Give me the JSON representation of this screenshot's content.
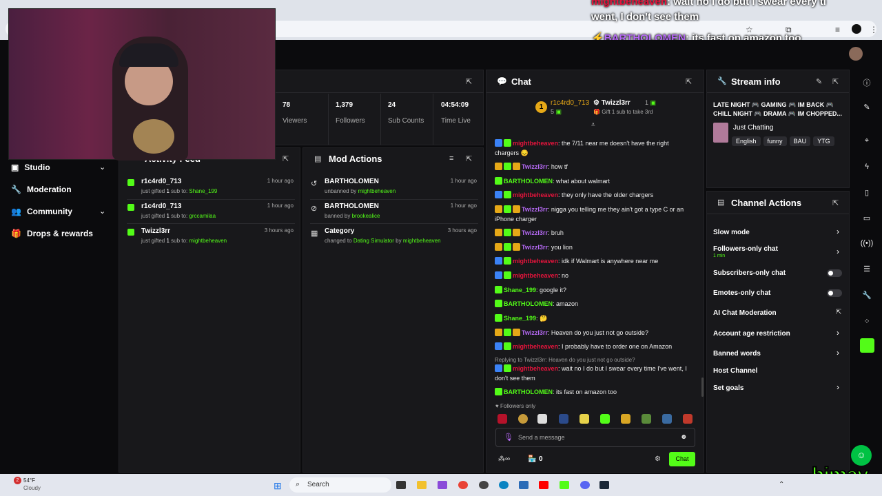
{
  "overlay": {
    "line1_user": "mightbeheaven",
    "line1_text": ": wait no I do but I swear every ti",
    "line2_text": "went, I don't see them",
    "line3_user": "BARTHOLOMEN",
    "line3_text": ": its fast on amazon too"
  },
  "sidebar": {
    "items": [
      {
        "label": "Studio",
        "icon": "video-icon",
        "chevron": true
      },
      {
        "label": "Moderation",
        "icon": "wrench-icon",
        "chevron": false
      },
      {
        "label": "Community",
        "icon": "users-icon",
        "chevron": true
      },
      {
        "label": "Drops & rewards",
        "icon": "gift-icon",
        "chevron": false
      }
    ]
  },
  "stats": [
    {
      "value": "78",
      "label": "Viewers"
    },
    {
      "value": "1,379",
      "label": "Followers"
    },
    {
      "value": "24",
      "label": "Sub Counts"
    },
    {
      "value": "04:54:09",
      "label": "Time Live"
    }
  ],
  "activity_feed": {
    "title": "Activity Feed",
    "items": [
      {
        "name": "r1c4rd0_713",
        "pre": "just gifted ",
        "count": "1",
        "mid": " sub to: ",
        "target": "Shane_199",
        "time": "1 hour ago"
      },
      {
        "name": "r1c4rd0_713",
        "pre": "just gifted ",
        "count": "1",
        "mid": " sub to: ",
        "target": "grccamilaa",
        "time": "1 hour ago"
      },
      {
        "name": "Twizzl3rr",
        "pre": "just gifted ",
        "count": "1",
        "mid": " sub to: ",
        "target": "mightbeheaven",
        "time": "3 hours ago"
      }
    ]
  },
  "mod_actions": {
    "title": "Mod Actions",
    "items": [
      {
        "name": "BARTHOLOMEN",
        "pre": "unbanned by ",
        "target": "mightbeheaven",
        "time": "1 hour ago",
        "icon": "undo-icon"
      },
      {
        "name": "BARTHOLOMEN",
        "pre": "banned by ",
        "target": "brookealice",
        "time": "1 hour ago",
        "icon": "ban-icon"
      },
      {
        "name": "Category",
        "pre": "changed to ",
        "target": "Dating Simulator",
        "post": " by ",
        "target2": "mightbeheaven",
        "time": "3 hours ago",
        "icon": "category-icon"
      }
    ]
  },
  "chat": {
    "title": "Chat",
    "gifter_name": "r1c4rd0_713",
    "gifter_count": "5",
    "gifter2_name": "Twizzl3rr",
    "gifter2_count": "1",
    "gift_prompt": "Gift 1 sub to take 3rd",
    "messages": [
      {
        "user": "mightbeheaven",
        "color": "red",
        "badges": [
          "blue",
          "green"
        ],
        "text": ": the 7/11 near me doesn't have the right chargers 😔"
      },
      {
        "user": "Twizzl3rr",
        "color": "purple",
        "badges": [
          "gold",
          "green",
          "gold"
        ],
        "text": ": how tf"
      },
      {
        "user": "BARTHOLOMEN",
        "color": "green",
        "badges": [
          "green"
        ],
        "text": ": what about walmart"
      },
      {
        "user": "mightbeheaven",
        "color": "red",
        "badges": [
          "blue",
          "green"
        ],
        "text": ": they only have the older chargers"
      },
      {
        "user": "Twizzl3rr",
        "color": "purple",
        "badges": [
          "gold",
          "green",
          "gold"
        ],
        "text": ": nigga you telling me they ain't got a type C or an iPhone charger"
      },
      {
        "user": "Twizzl3rr",
        "color": "purple",
        "badges": [
          "gold",
          "green",
          "gold"
        ],
        "text": ": bruh"
      },
      {
        "user": "Twizzl3rr",
        "color": "purple",
        "badges": [
          "gold",
          "green",
          "gold"
        ],
        "text": ": you lion"
      },
      {
        "user": "mightbeheaven",
        "color": "red",
        "badges": [
          "blue",
          "green"
        ],
        "text": ": idk if Walmart is anywhere near me"
      },
      {
        "user": "mightbeheaven",
        "color": "red",
        "badges": [
          "blue",
          "green"
        ],
        "text": ": no"
      },
      {
        "user": "Shane_199",
        "color": "green",
        "badges": [
          "green"
        ],
        "text": ": google it?"
      },
      {
        "user": "BARTHOLOMEN",
        "color": "green",
        "badges": [
          "green"
        ],
        "text": ": amazon"
      },
      {
        "user": "Shane_199",
        "color": "green",
        "badges": [
          "green"
        ],
        "text": ": 🤔"
      },
      {
        "user": "Twizzl3rr",
        "color": "purple",
        "badges": [
          "gold",
          "green",
          "gold"
        ],
        "text": ": Heaven do you just not go outside?"
      },
      {
        "user": "mightbeheaven",
        "color": "red",
        "badges": [
          "blue",
          "green"
        ],
        "text": ": I probably have to order one on Amazon"
      },
      {
        "reply": "Replying to Twizzl3rr: Heaven do you just not go outside?"
      },
      {
        "user": "mightbeheaven",
        "color": "red",
        "badges": [
          "blue",
          "green"
        ],
        "text": ": wait no I do but I swear every time I've went, I don't see them"
      },
      {
        "user": "BARTHOLOMEN",
        "color": "green",
        "badges": [
          "green"
        ],
        "text": ": its fast on amazon too"
      }
    ],
    "followers_only": "Followers only",
    "input_placeholder": "Send a message",
    "points": "0",
    "chat_button": "Chat"
  },
  "stream_info": {
    "title": "Stream info",
    "stream_title": "LATE NIGHT 🎮 GAMING 🎮 IM BACK 🎮 CHILL NIGHT 🎮 DRAMA 🎮 IM CHOPPED...",
    "category": "Just Chatting",
    "tags": [
      "English",
      "funny",
      "BAU",
      "YTG"
    ]
  },
  "channel_actions": {
    "title": "Channel Actions",
    "rows": [
      {
        "label": "Slow mode",
        "control": "chevron"
      },
      {
        "label": "Followers-only chat",
        "sub": "1 min",
        "control": "chevron"
      },
      {
        "label": "Subscribers-only chat",
        "control": "toggle"
      },
      {
        "label": "Emotes-only chat",
        "control": "toggle"
      },
      {
        "label": "AI Chat Moderation",
        "control": "external"
      },
      {
        "label": "Account age restriction",
        "control": "chevron"
      },
      {
        "label": "Banned words",
        "control": "chevron"
      },
      {
        "label": "Host Channel",
        "control": "none"
      },
      {
        "label": "Set goals",
        "control": "chevron"
      }
    ]
  },
  "taskbar": {
    "weather_temp": "54°F",
    "weather_desc": "Cloudy",
    "search_placeholder": "Search",
    "notif_count": "2"
  },
  "watermark": "himay",
  "colors": {
    "accent": "#53fc18",
    "panel": "#18181b",
    "bg": "#0b0b0d"
  }
}
